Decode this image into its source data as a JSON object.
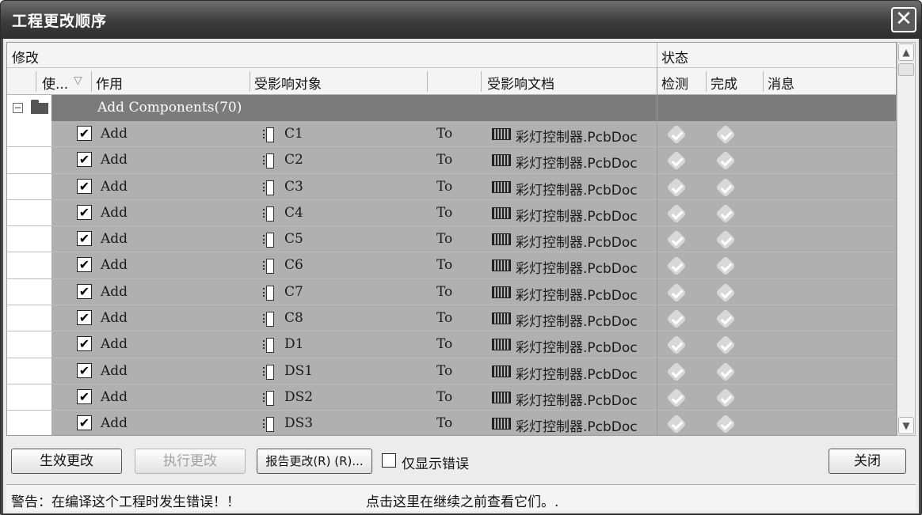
{
  "window": {
    "title": "工程更改顺序",
    "close_glyph": "✕"
  },
  "header": {
    "group_modify": "修改",
    "group_status": "状态",
    "col_enable": "使...",
    "col_enable_sort": "▽",
    "col_action": "作用",
    "col_affected_object": "受影响对象",
    "col_affected_document": "受影响文档",
    "col_check": "检测",
    "col_done": "完成",
    "col_message": "消息"
  },
  "group": {
    "expander": "−",
    "label": "Add Components(70)"
  },
  "rows": [
    {
      "checked": "✔",
      "action": "Add",
      "object": "C1",
      "to": "To",
      "document": "彩灯控制器.PcbDoc"
    },
    {
      "checked": "✔",
      "action": "Add",
      "object": "C2",
      "to": "To",
      "document": "彩灯控制器.PcbDoc"
    },
    {
      "checked": "✔",
      "action": "Add",
      "object": "C3",
      "to": "To",
      "document": "彩灯控制器.PcbDoc"
    },
    {
      "checked": "✔",
      "action": "Add",
      "object": "C4",
      "to": "To",
      "document": "彩灯控制器.PcbDoc"
    },
    {
      "checked": "✔",
      "action": "Add",
      "object": "C5",
      "to": "To",
      "document": "彩灯控制器.PcbDoc"
    },
    {
      "checked": "✔",
      "action": "Add",
      "object": "C6",
      "to": "To",
      "document": "彩灯控制器.PcbDoc"
    },
    {
      "checked": "✔",
      "action": "Add",
      "object": "C7",
      "to": "To",
      "document": "彩灯控制器.PcbDoc"
    },
    {
      "checked": "✔",
      "action": "Add",
      "object": "C8",
      "to": "To",
      "document": "彩灯控制器.PcbDoc"
    },
    {
      "checked": "✔",
      "action": "Add",
      "object": "D1",
      "to": "To",
      "document": "彩灯控制器.PcbDoc"
    },
    {
      "checked": "✔",
      "action": "Add",
      "object": "DS1",
      "to": "To",
      "document": "彩灯控制器.PcbDoc"
    },
    {
      "checked": "✔",
      "action": "Add",
      "object": "DS2",
      "to": "To",
      "document": "彩灯控制器.PcbDoc"
    },
    {
      "checked": "✔",
      "action": "Add",
      "object": "DS3",
      "to": "To",
      "document": "彩灯控制器.PcbDoc"
    }
  ],
  "scrollbar": {
    "up": "▲",
    "down": "▼"
  },
  "buttons": {
    "validate": "生效更改",
    "execute": "执行更改",
    "report": "报告更改(R) (R)...",
    "only_errors": "仅显示错误",
    "close": "关闭"
  },
  "status": {
    "warning": "警告：在编译这个工程时发生错误！！",
    "hint": "点击这里在继续之前查看它们。."
  }
}
